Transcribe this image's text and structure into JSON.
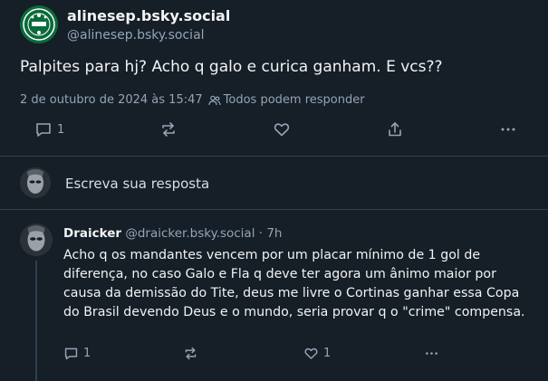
{
  "post": {
    "display_name": "alinesep.bsky.social",
    "handle": "@alinesep.bsky.social",
    "text": "Palpites para hj? Acho q galo e curica ganham. E vcs??",
    "timestamp": "2 de outubro de 2024 às 15:47",
    "reply_setting": "Todos podem responder",
    "reply_count": "1",
    "icons": {
      "reply": "speech-bubble-icon",
      "repost": "repost-arrows-icon",
      "like": "heart-icon",
      "share": "share-icon",
      "more": "more-dots-icon",
      "people": "people-icon"
    }
  },
  "composer": {
    "prompt": "Escreva sua resposta"
  },
  "reply": {
    "author_name": "Draicker",
    "author_handle": "@draicker.bsky.social",
    "age": "· 7h",
    "text": "Acho q os mandantes vencem por um placar mínimo de 1 gol de diferença, no caso Galo e Fla q deve ter agora um ânimo maior por causa da demissão do Tite, deus me livre o Cortinas ganhar essa Copa do Brasil devendo Deus e o mundo, seria provar q o \"crime\" compensa.",
    "reply_count": "1",
    "like_count": "1"
  },
  "colors": {
    "background": "#161e27",
    "text": "#f1f3f5",
    "muted": "#93a5b7",
    "divider": "#2e4052",
    "avatar_green": "#0b6b3a"
  }
}
